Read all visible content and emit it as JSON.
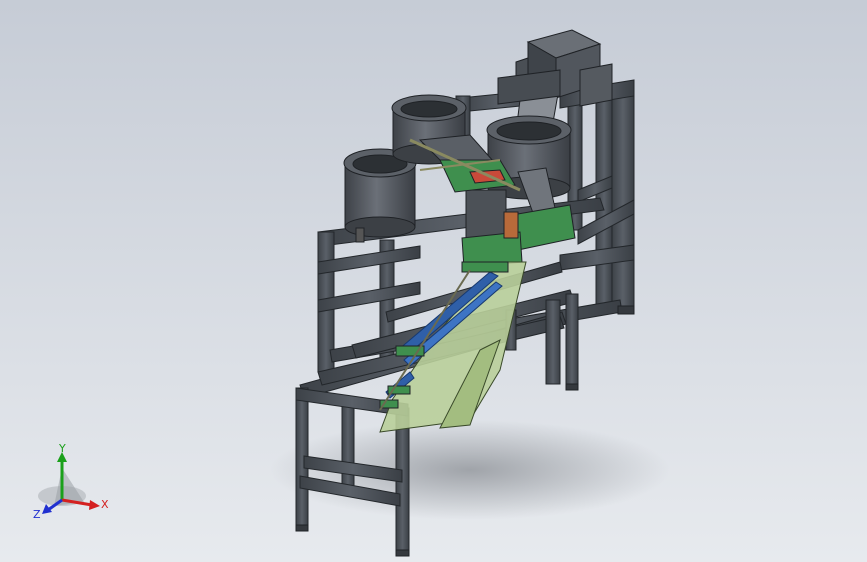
{
  "viewport": {
    "background_top": "#c6ccd6",
    "background_bottom": "#e7eaee"
  },
  "model": {
    "frame_color": "#4a5058",
    "frame_edge": "#2a2e33",
    "bowl_color": "#5a5f66",
    "board_color": "#3f8f4e",
    "chute_color": "#b9cf9a",
    "rail_color": "#2f5fa8"
  },
  "triad": {
    "x_label": "X",
    "y_label": "Y",
    "z_label": "Z",
    "x_color": "#d42020",
    "y_color": "#1aa01a",
    "z_color": "#2030d0"
  }
}
